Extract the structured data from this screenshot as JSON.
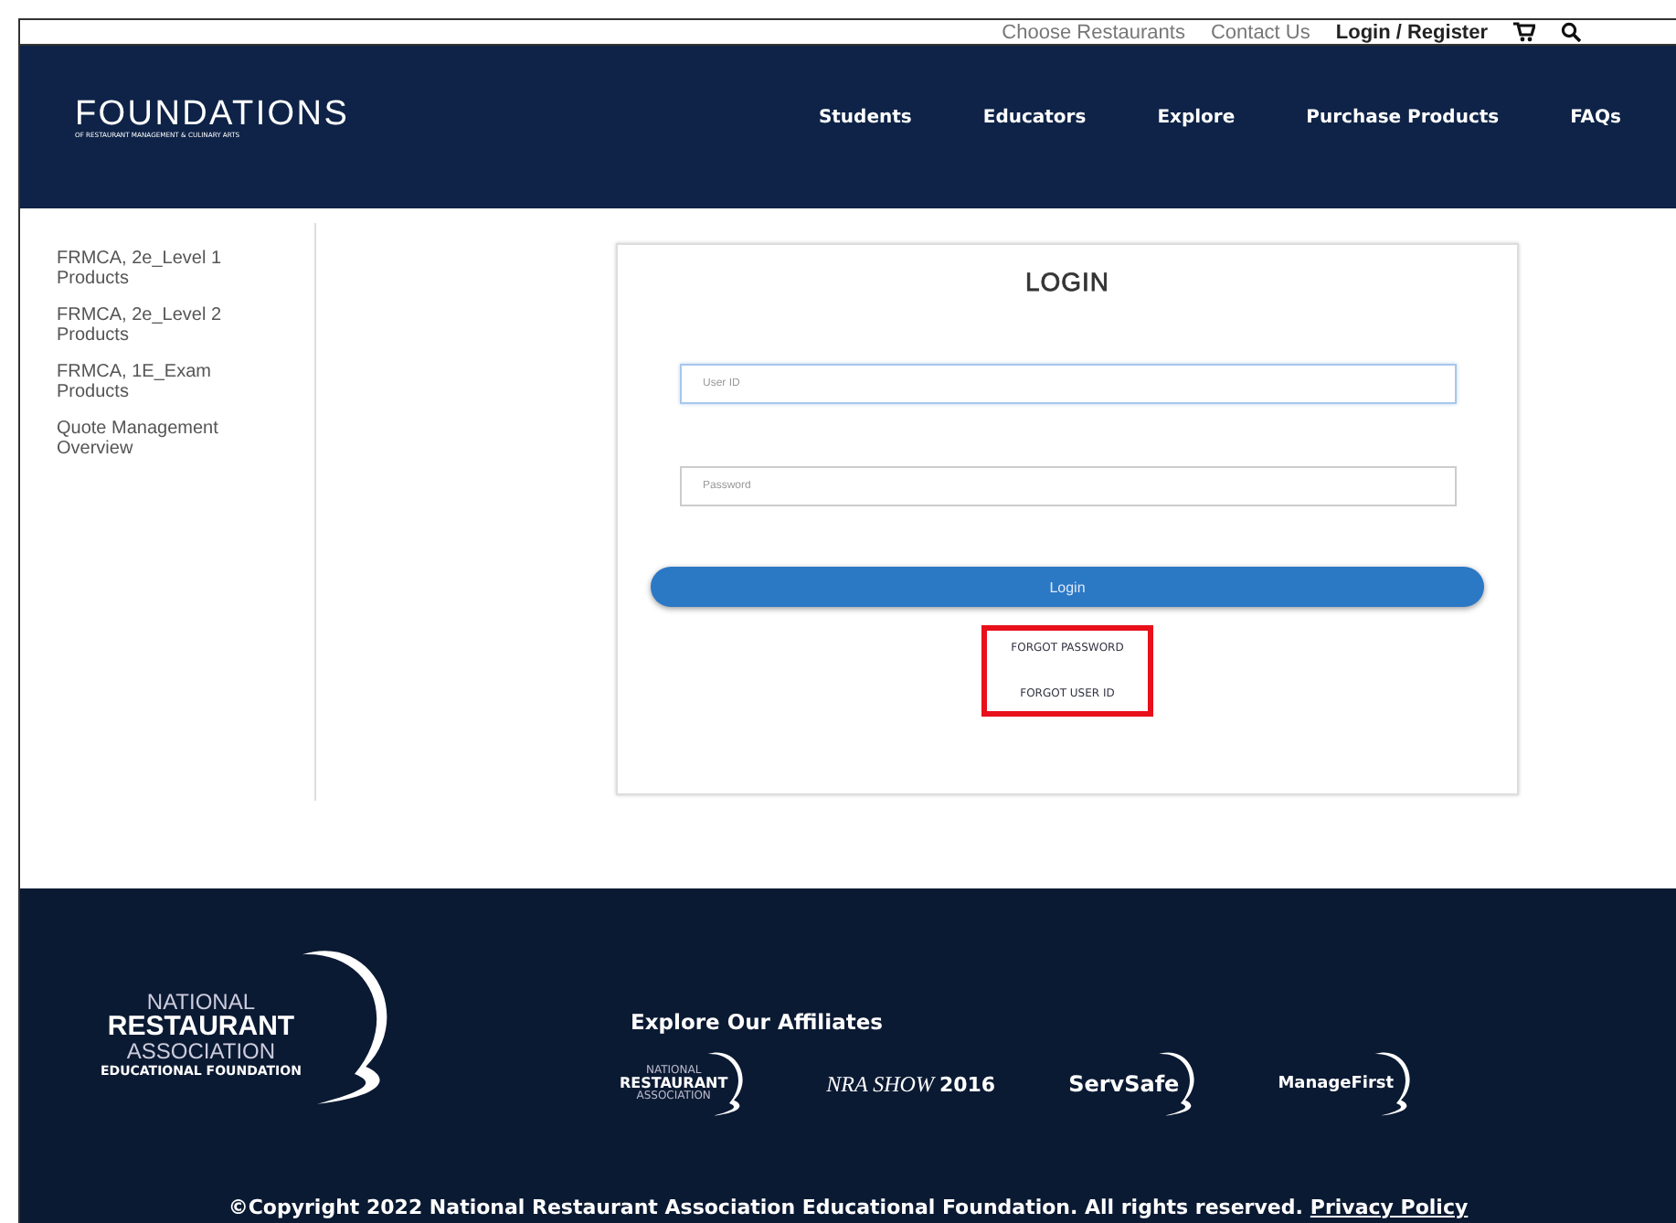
{
  "top_bar": {
    "links": [
      {
        "label": "Choose Restaurants",
        "bold": false
      },
      {
        "label": "Contact Us",
        "bold": false
      },
      {
        "label": "Login / Register",
        "bold": true
      }
    ]
  },
  "brand": {
    "name": "FOUNDATIONS",
    "tagline": "OF RESTAURANT MANAGEMENT & CULINARY ARTS"
  },
  "nav": [
    "Students",
    "Educators",
    "Explore",
    "Purchase Products",
    "FAQs"
  ],
  "sidebar": {
    "items": [
      "FRMCA, 2e_Level 1 Products",
      "FRMCA, 2e_Level 2 Products",
      "FRMCA, 1E_Exam Products",
      "Quote Management Overview"
    ]
  },
  "login": {
    "title": "LOGIN",
    "fields": [
      {
        "placeholder": "User ID",
        "focused": true
      },
      {
        "placeholder": "Password",
        "focused": false
      }
    ],
    "button": "Login",
    "links": [
      "FORGOT PASSWORD",
      "FORGOT USER ID"
    ],
    "links_highlighted": true
  },
  "footer": {
    "logo": [
      "NATIONAL",
      "RESTAURANT",
      "ASSOCIATION",
      "EDUCATIONAL FOUNDATION"
    ],
    "affiliates_title": "Explore Our Affiliates",
    "affiliates": [
      {
        "kind": "nra",
        "lines": [
          "NATIONAL",
          "RESTAURANT",
          "ASSOCIATION"
        ]
      },
      {
        "kind": "show",
        "lines": [
          "NRA SHOW",
          "2016"
        ]
      },
      {
        "kind": "swoosh",
        "lines": [
          "ServSafe"
        ]
      },
      {
        "kind": "swoosh",
        "lines": [
          "ManageFirst"
        ]
      }
    ],
    "copyright": "©Copyright 2022 National Restaurant Association Educational Foundation. All rights reserved.",
    "privacy": "Privacy Policy"
  }
}
